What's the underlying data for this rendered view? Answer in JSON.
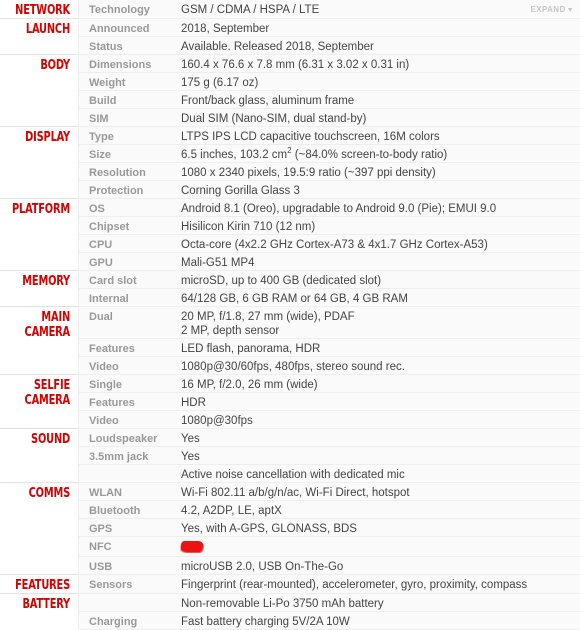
{
  "expand": {
    "label": "EXPAND",
    "caret": "▼"
  },
  "colors": {
    "category": "#d50000",
    "spec_name": "#999999",
    "spec_value": "#444444",
    "redaction": "#ee1111",
    "row_background": "#fafafa"
  },
  "sections": [
    {
      "category": "NETWORK",
      "rows": [
        {
          "name": "Technology",
          "value": "GSM / CDMA / HSPA / LTE",
          "has_expand": true
        }
      ]
    },
    {
      "category": "LAUNCH",
      "rows": [
        {
          "name": "Announced",
          "value": "2018, September"
        },
        {
          "name": "Status",
          "value": "Available. Released 2018, September"
        }
      ]
    },
    {
      "category": "BODY",
      "rows": [
        {
          "name": "Dimensions",
          "value": "160.4 x 76.6 x 7.8 mm (6.31 x 3.02 x 0.31 in)"
        },
        {
          "name": "Weight",
          "value": "175 g (6.17 oz)"
        },
        {
          "name": "Build",
          "value": "Front/back glass, aluminum frame"
        },
        {
          "name": "SIM",
          "value": "Dual SIM (Nano-SIM, dual stand-by)"
        }
      ]
    },
    {
      "category": "DISPLAY",
      "rows": [
        {
          "name": "Type",
          "value": "LTPS IPS LCD capacitive touchscreen, 16M colors"
        },
        {
          "name": "Size",
          "value_html": "6.5 inches, 103.2 cm<sup>2</sup> (~84.0% screen-to-body ratio)",
          "value": "6.5 inches, 103.2 cm2 (~84.0% screen-to-body ratio)"
        },
        {
          "name": "Resolution",
          "value": "1080 x 2340 pixels, 19.5:9 ratio (~397 ppi density)"
        },
        {
          "name": "Protection",
          "value": "Corning Gorilla Glass 3"
        }
      ]
    },
    {
      "category": "PLATFORM",
      "rows": [
        {
          "name": "OS",
          "value": "Android 8.1 (Oreo), upgradable to Android 9.0 (Pie); EMUI 9.0"
        },
        {
          "name": "Chipset",
          "value": "Hisilicon Kirin 710 (12 nm)"
        },
        {
          "name": "CPU",
          "value": "Octa-core (4x2.2 GHz Cortex-A73 & 4x1.7 GHz Cortex-A53)"
        },
        {
          "name": "GPU",
          "value": "Mali-G51 MP4"
        }
      ]
    },
    {
      "category": "MEMORY",
      "rows": [
        {
          "name": "Card slot",
          "value": "microSD, up to 400 GB (dedicated slot)"
        },
        {
          "name": "Internal",
          "value": "64/128 GB, 6 GB RAM or 64 GB, 4 GB RAM"
        }
      ]
    },
    {
      "category": "MAIN CAMERA",
      "category_lines": [
        "MAIN",
        "CAMERA"
      ],
      "rows": [
        {
          "name": "Dual",
          "value": "20 MP, f/1.8, 27 mm (wide), PDAF",
          "value2": "2 MP, depth sensor",
          "tall": true
        },
        {
          "name": "Features",
          "value": "LED flash, panorama, HDR"
        },
        {
          "name": "Video",
          "value": "1080p@30/60fps, 480fps, stereo sound rec."
        }
      ]
    },
    {
      "category": "SELFIE CAMERA",
      "category_lines": [
        "SELFIE",
        "CAMERA"
      ],
      "rows": [
        {
          "name": "Single",
          "value": "16 MP, f/2.0, 26 mm (wide)"
        },
        {
          "name": "Features",
          "value": "HDR"
        },
        {
          "name": "Video",
          "value": "1080p@30fps"
        }
      ]
    },
    {
      "category": "SOUND",
      "rows": [
        {
          "name": "Loudspeaker",
          "value": "Yes"
        },
        {
          "name": "3.5mm jack",
          "value": "Yes"
        },
        {
          "name": "",
          "value": "Active noise cancellation with dedicated mic"
        }
      ]
    },
    {
      "category": "COMMS",
      "rows": [
        {
          "name": "WLAN",
          "value": "Wi-Fi 802.11 a/b/g/n/ac, Wi-Fi Direct, hotspot"
        },
        {
          "name": "Bluetooth",
          "value": "4.2, A2DP, LE, aptX"
        },
        {
          "name": "GPS",
          "value": "Yes, with A-GPS, GLONASS, BDS"
        },
        {
          "name": "NFC",
          "value": "",
          "redacted": true
        },
        {
          "name": "USB",
          "value": "microUSB 2.0, USB On-The-Go"
        }
      ]
    },
    {
      "category": "FEATURES",
      "rows": [
        {
          "name": "Sensors",
          "value": "Fingerprint (rear-mounted), accelerometer, gyro, proximity, compass"
        }
      ]
    },
    {
      "category": "BATTERY",
      "rows": [
        {
          "name": "",
          "value": "Non-removable Li-Po 3750 mAh battery"
        },
        {
          "name": "Charging",
          "value": "Fast battery charging 5V/2A 10W"
        }
      ]
    }
  ]
}
